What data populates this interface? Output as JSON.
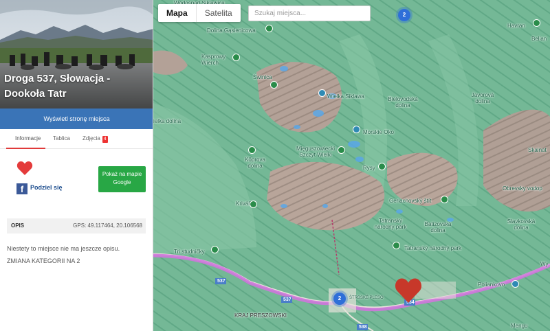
{
  "panel": {
    "title": "Droga 537, Słowacja - Dookoła Tatr",
    "show_page_button": "Wyświetl stronę miejsca",
    "tabs": [
      {
        "label": "Informacje"
      },
      {
        "label": "Tablica"
      },
      {
        "label": "Zdjęcia",
        "badge": "4"
      }
    ],
    "share_label": "Podziel się",
    "share_icon": "f",
    "google_button": "Pokaż na mapie Google",
    "opis_label": "OPIS",
    "gps": "GPS: 49.117464, 20.106568",
    "description_line1": "Niestety to miejsce nie ma jeszcze opisu.",
    "description_line2": "ZMIANA KATEGORII NA 2",
    "accent_color": "#e03a3a",
    "heart_color": "#e43b3b"
  },
  "map": {
    "type_buttons": {
      "map": "Mapa",
      "satellite": "Satelita"
    },
    "search_placeholder": "Szukaj miejsca...",
    "clusters": [
      "2",
      "2",
      "2"
    ],
    "labels": {
      "wodospad": "Wodospad Siklawica",
      "gasienicowa": "Dolina Gąsienicowa",
      "kasprowy": "Kasprowy Wierch",
      "swinica": "Świnica",
      "wielka_siklawa": "Wielka Siklawa",
      "bielovodska": "Bielovodská dolina",
      "javorova": "Javorová dolina",
      "havran": "Havran",
      "belianske": "Belian",
      "morskie_oko": "Morskie Oko",
      "wielka_dolina": "ielka dolina",
      "mieguszowiecki": "Mięguszowiecki Szczyt Wielki",
      "kôprova": "Kôprova dolina",
      "rysy": "Rysy",
      "skalnata": "Skalnat",
      "obrevsky": "Obrevsky vodop",
      "krivan": "Kriváň",
      "gerlach": "Gerlachovský štít",
      "tatransky_np": "Tatranský národný park",
      "batizovska": "Batizovská dolina",
      "slavkovska": "Slavkovská dolina",
      "tatransky_np2": "Tatranský národný park",
      "tri_studnicky": "Tri studničky",
      "poliankovo": "Poliankovo",
      "wy": "Wy",
      "strbske": "ŠTRBSKÉ PLESO",
      "kraj": "KRAJ PRESZOWSKI",
      "road_537a": "537",
      "road_537b": "537",
      "road_538": "538",
      "road_534": "534",
      "mozgov": "Mengu"
    },
    "heart_color": "#c7382a",
    "route_color": "#cf76dc"
  }
}
